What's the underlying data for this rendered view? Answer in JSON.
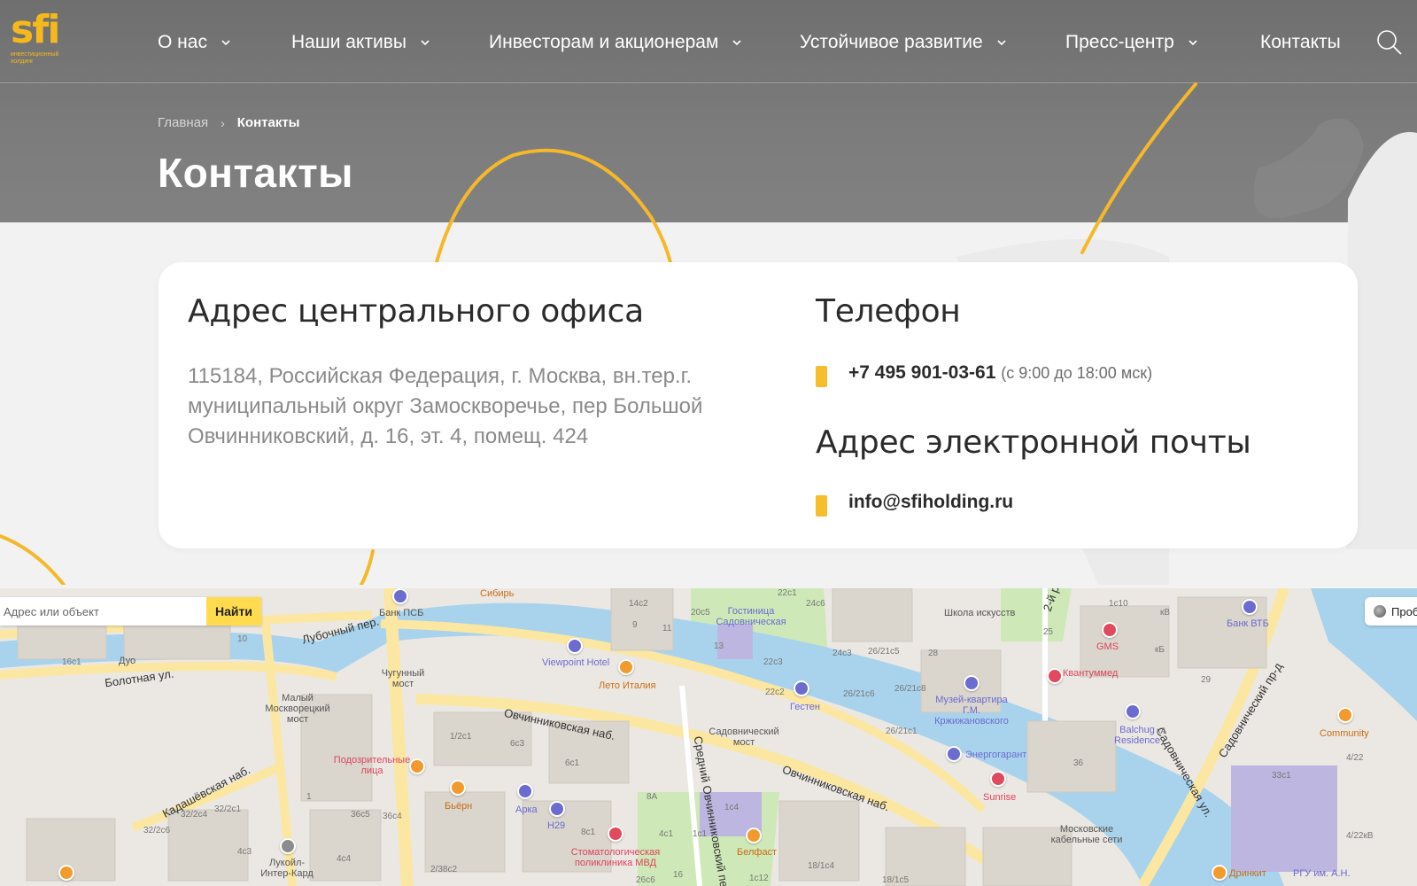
{
  "header": {
    "logo_text": "sfi",
    "logo_subtitle": "инвестиционный холдинг",
    "nav": [
      {
        "label": "О нас"
      },
      {
        "label": "Наши активы"
      },
      {
        "label": "Инвесторам и акционерам"
      },
      {
        "label": "Устойчивое развитие"
      },
      {
        "label": "Пресс-центр"
      },
      {
        "label": "Контакты"
      }
    ]
  },
  "breadcrumb": {
    "home": "Главная",
    "separator": "›",
    "current": "Контакты"
  },
  "page_title": "Контакты",
  "contacts": {
    "address_heading": "Адрес центрального офиса",
    "address": "115184, Российская Федерация, г. Москва, вн.тер.г. муниципальный округ Замоскворечье, пер Большой Овчинниковский, д. 16, эт. 4, помещ. 424",
    "phone_heading": "Телефон",
    "phone": "+7 495 901-03-61",
    "phone_hours": "(с 9:00 до 18:00 мск)",
    "email_heading": "Адрес электронной почты",
    "email": "info@sfiholding.ru"
  },
  "map": {
    "search_placeholder": "Адрес или объект",
    "find_label": "Найти",
    "traffic_label": "Проб",
    "streets": [
      "Лубочный пер.",
      "Болотная ул.",
      "Кадашёвская наб.",
      "Овчинниковская наб.",
      "Овчинниковская наб.",
      "Средний Овчинниковский пер.",
      "Садовническая ул.",
      "Садовнический пр-д",
      "2-й р"
    ],
    "places": [
      {
        "label": "Банк ПСБ",
        "kind": "blue"
      },
      {
        "label": "Сибирь",
        "kind": "orange"
      },
      {
        "label": "Гостиница Садовническая",
        "kind": "blue"
      },
      {
        "label": "Школа искусств",
        "kind": "grey"
      },
      {
        "label": "Банк ВТБ",
        "kind": "blue"
      },
      {
        "label": "GMS",
        "kind": "red"
      },
      {
        "label": "Квантуммед",
        "kind": "red"
      },
      {
        "label": "Viewpoint Hotel",
        "kind": "blue"
      },
      {
        "label": "Лето Италия",
        "kind": "orange"
      },
      {
        "label": "Гестен",
        "kind": "blue"
      },
      {
        "label": "Музей-квартира Г.М. Кржижановского",
        "kind": "blue"
      },
      {
        "label": "Balchug Residence",
        "kind": "blue"
      },
      {
        "label": "Community",
        "kind": "orange"
      },
      {
        "label": "Энергогарант",
        "kind": "blue"
      },
      {
        "label": "Sunrise",
        "kind": "red"
      },
      {
        "label": "Подозрительные лица",
        "kind": "red"
      },
      {
        "label": "Бьёрн",
        "kind": "orange"
      },
      {
        "label": "Арка",
        "kind": "blue"
      },
      {
        "label": "H29",
        "kind": "blue"
      },
      {
        "label": "Стоматологическая поликлиника МВД",
        "kind": "red"
      },
      {
        "label": "Белфаст",
        "kind": "orange"
      },
      {
        "label": "Московские кабельные сети",
        "kind": "grey"
      },
      {
        "label": "Дринкит",
        "kind": "orange"
      },
      {
        "label": "РГУ им. А.Н.",
        "kind": "blue"
      },
      {
        "label": "Лукойл-Интер-Кард",
        "kind": "grey"
      },
      {
        "label": "Малый Москворецкий мост",
        "kind": "grey"
      },
      {
        "label": "Чугунный мост",
        "kind": "grey"
      },
      {
        "label": "Садовнический мост",
        "kind": "grey"
      },
      {
        "label": "Дуо",
        "kind": "grey"
      }
    ],
    "house_numbers": [
      "16с1",
      "10",
      "14с2",
      "9",
      "11",
      "20с5",
      "22с1",
      "24с6",
      "13",
      "22с3",
      "22с2",
      "24с3",
      "26/21с5",
      "28",
      "26/21с6",
      "26/21с8",
      "26/21с1",
      "1с10",
      "25",
      "кВ",
      "кБ",
      "29",
      "кА",
      "36",
      "33с1",
      "4/22",
      "4/22кВ",
      "1/2с1",
      "6с3",
      "6с1",
      "8А",
      "8с1",
      "1с4",
      "1с1",
      "4с1",
      "16",
      "18/1с4",
      "18/1с5",
      "1с12",
      "26с6",
      "2/38с2",
      "4с3",
      "4с4",
      "32/2с1",
      "32/2с4",
      "32/2с6",
      "36с5",
      "36с4",
      "1"
    ],
    "colors": {
      "water": "#a9d3ec",
      "road_major": "#fbe7a1",
      "park": "#cfe8b8",
      "building": "#d9d4cc"
    }
  },
  "colors": {
    "accent": "#f6be2c",
    "hero_bg": "#757575",
    "card_bg": "#ffffff"
  }
}
